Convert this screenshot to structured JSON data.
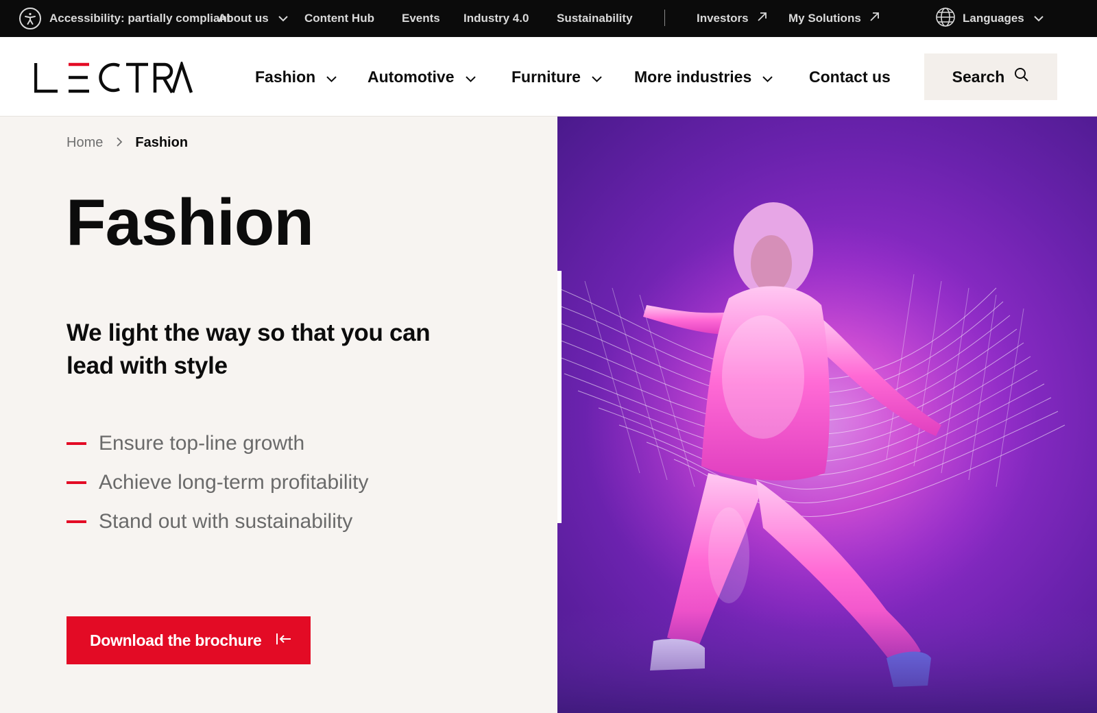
{
  "topbar": {
    "accessibility": "Accessibility: partially compliant",
    "about": "About us",
    "content_hub": "Content Hub",
    "events": "Events",
    "industry": "Industry 4.0",
    "sustainability": "Sustainability",
    "investors": "Investors",
    "my_solutions": "My Solutions",
    "languages": "Languages"
  },
  "header": {
    "logo_text": "LECTRA",
    "nav": {
      "fashion": "Fashion",
      "automotive": "Automotive",
      "furniture": "Furniture",
      "more": "More industries",
      "contact": "Contact us"
    },
    "search": "Search"
  },
  "breadcrumb": {
    "home": "Home",
    "current": "Fashion"
  },
  "hero": {
    "title": "Fashion",
    "subtitle": "We light the way so that you can lead with style",
    "bullets": [
      "Ensure top-line growth",
      "Achieve long-term profitability",
      "Stand out with sustainability"
    ],
    "cta": "Download the brochure"
  },
  "colors": {
    "accent": "#e30b25",
    "topbar_bg": "#0b0b0b",
    "page_bg": "#f7f4f1",
    "hero_purple": "#8c2bc6"
  },
  "icons": {
    "accessibility": "accessibility-icon",
    "globe": "globe-icon",
    "external": "external-link-icon",
    "search": "search-icon",
    "download": "download-icon"
  }
}
